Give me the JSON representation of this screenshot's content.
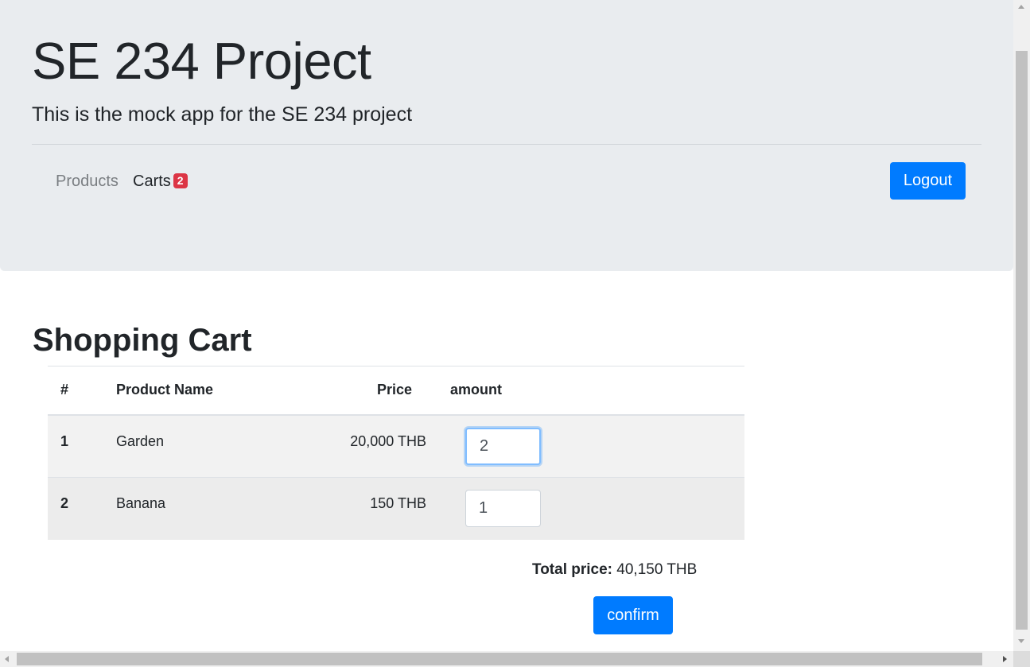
{
  "header": {
    "title": "SE 234 Project",
    "subtitle": "This is the mock app for the SE 234 project",
    "nav": {
      "products_label": "Products",
      "carts_label": "Carts",
      "carts_badge": "2"
    },
    "logout_label": "Logout"
  },
  "cart": {
    "heading": "Shopping Cart",
    "columns": [
      "#",
      "Product Name",
      "Price",
      "amount"
    ],
    "rows": [
      {
        "index": "1",
        "name": "Garden",
        "price": "20,000 THB",
        "amount": "2"
      },
      {
        "index": "2",
        "name": "Banana",
        "price": "150 THB",
        "amount": "1"
      }
    ],
    "total_label": "Total price:",
    "total_value": "40,150 THB",
    "confirm_label": "confirm"
  },
  "colors": {
    "primary": "#007bff",
    "badge": "#dc3545",
    "jumbotron_bg": "#e9ecef"
  }
}
